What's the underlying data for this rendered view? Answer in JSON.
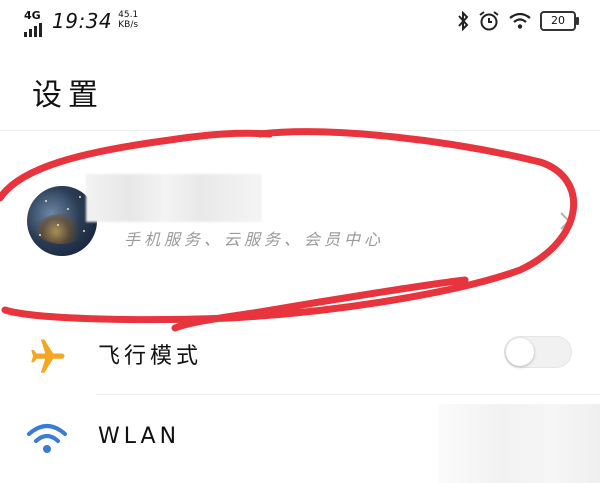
{
  "status_bar": {
    "network": "4G",
    "time": "19:34",
    "speed_value": "45.1",
    "speed_unit": "KB/s",
    "icons": [
      "bluetooth-icon",
      "alarm-icon",
      "wifi-icon",
      "battery-icon"
    ],
    "battery": "20"
  },
  "page": {
    "title": "设置"
  },
  "account": {
    "subtitle": "手机服务、云服务、会员中心"
  },
  "rows": [
    {
      "label": "飞行模式",
      "icon": "airplane-icon",
      "toggle": false,
      "icon_color": "#f5a623"
    },
    {
      "label": "WLAN",
      "icon": "wifi-icon",
      "icon_color": "#3a7bd5"
    }
  ],
  "annotation_color": "#e8343c"
}
